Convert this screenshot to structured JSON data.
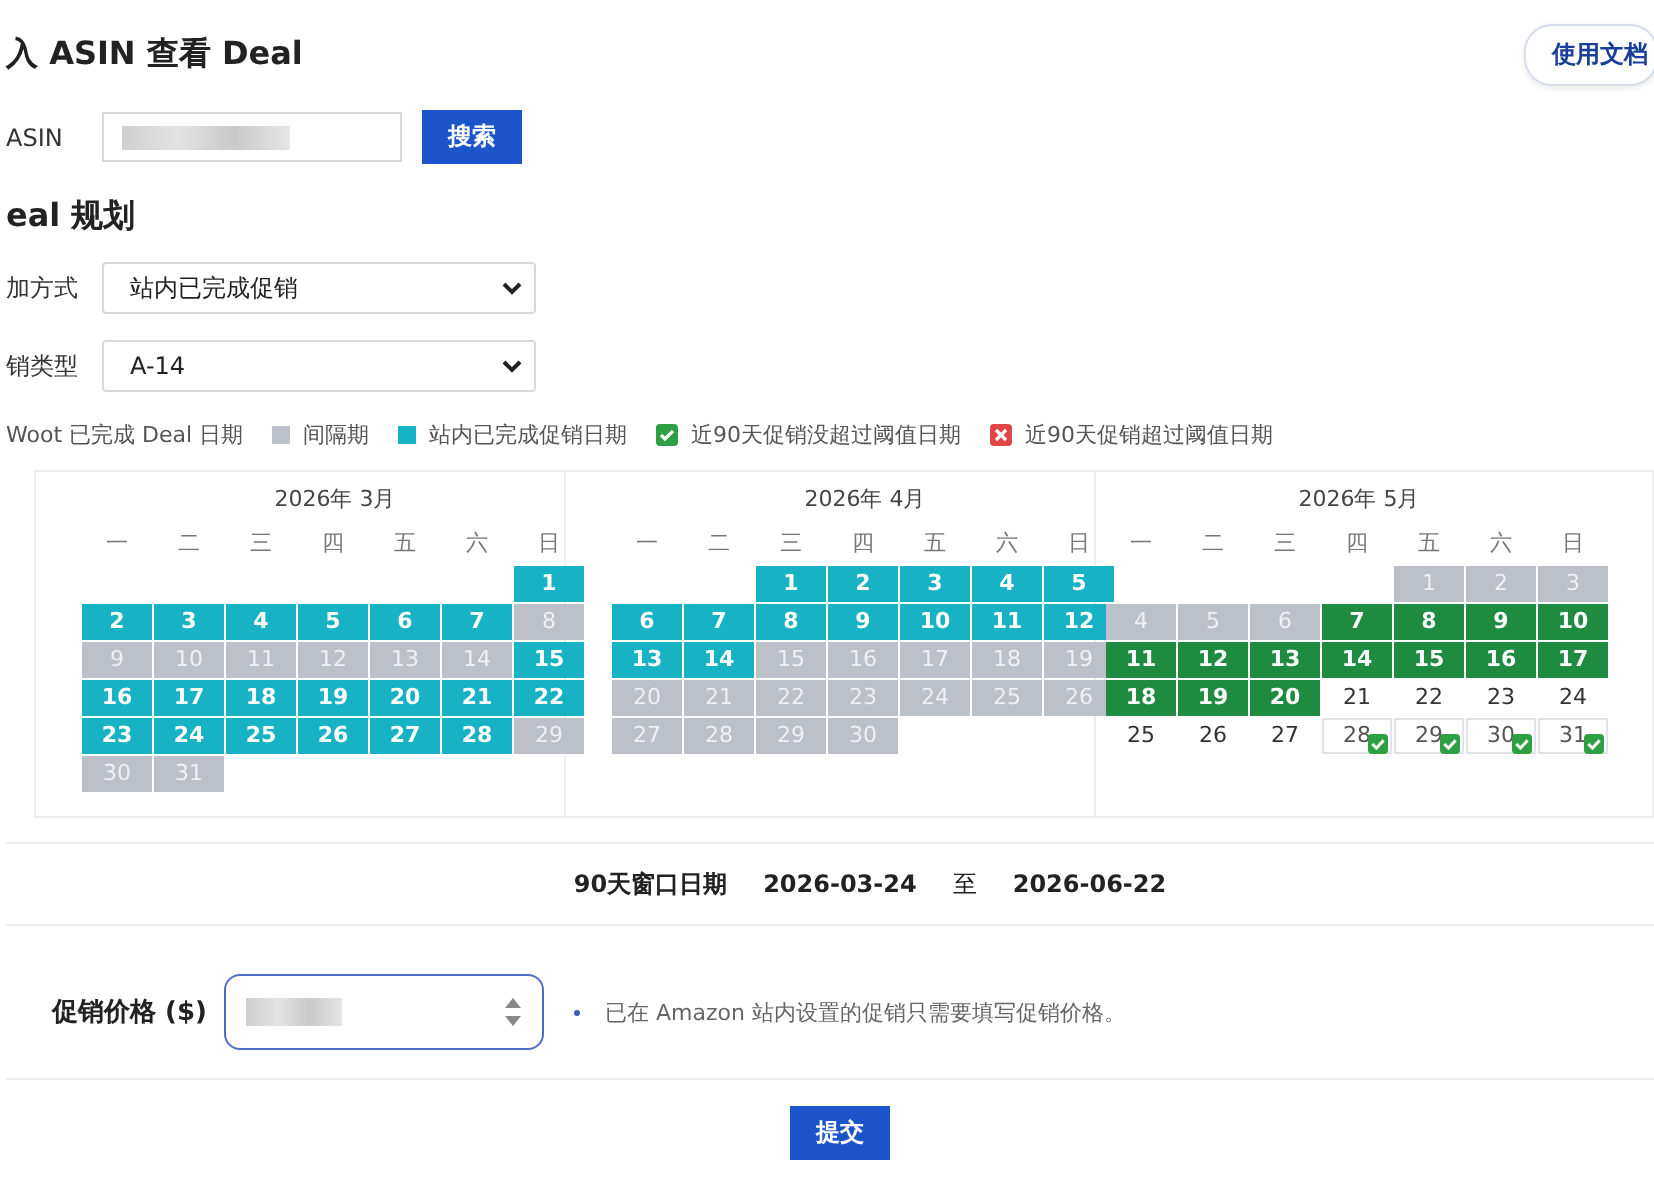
{
  "header": {
    "title": "入 ASIN 查看 Deal",
    "docs_button": "使用文档"
  },
  "asin": {
    "label": "ASIN",
    "button": "搜索"
  },
  "plan": {
    "title": "eal 规划",
    "fields": [
      {
        "label": "加方式",
        "value": "站内已完成促销"
      },
      {
        "label": "销类型",
        "value": "A-14"
      }
    ]
  },
  "legend": [
    {
      "label": "Woot 已完成 Deal 日期"
    },
    {
      "kind": "gap",
      "label": "间隔期"
    },
    {
      "kind": "promo",
      "label": "站内已完成促销日期"
    },
    {
      "kind": "ok",
      "label": "近90天促销没超过阈值日期"
    },
    {
      "kind": "over",
      "label": "近90天促销超过阈值日期"
    }
  ],
  "months": [
    {
      "title": "2026年 3月",
      "weekdays": [
        "一",
        "二",
        "三",
        "四",
        "五",
        "六",
        "日"
      ],
      "weeks": [
        [
          {
            "kind": "blank"
          },
          {
            "kind": "blank"
          },
          {
            "kind": "blank"
          },
          {
            "kind": "blank"
          },
          {
            "kind": "blank"
          },
          {
            "kind": "blank"
          },
          {
            "day": "1",
            "kind": "promo"
          }
        ],
        [
          {
            "day": "2",
            "kind": "promo"
          },
          {
            "day": "3",
            "kind": "promo"
          },
          {
            "day": "4",
            "kind": "promo"
          },
          {
            "day": "5",
            "kind": "promo"
          },
          {
            "day": "6",
            "kind": "promo"
          },
          {
            "day": "7",
            "kind": "promo"
          },
          {
            "day": "8",
            "kind": "gap"
          }
        ],
        [
          {
            "day": "9",
            "kind": "gap"
          },
          {
            "day": "10",
            "kind": "gap"
          },
          {
            "day": "11",
            "kind": "gap"
          },
          {
            "day": "12",
            "kind": "gap"
          },
          {
            "day": "13",
            "kind": "gap"
          },
          {
            "day": "14",
            "kind": "gap"
          },
          {
            "day": "15",
            "kind": "promo"
          }
        ],
        [
          {
            "day": "16",
            "kind": "promo"
          },
          {
            "day": "17",
            "kind": "promo"
          },
          {
            "day": "18",
            "kind": "promo"
          },
          {
            "day": "19",
            "kind": "promo"
          },
          {
            "day": "20",
            "kind": "promo"
          },
          {
            "day": "21",
            "kind": "promo"
          },
          {
            "day": "22",
            "kind": "promo"
          }
        ],
        [
          {
            "day": "23",
            "kind": "promo"
          },
          {
            "day": "24",
            "kind": "promo"
          },
          {
            "day": "25",
            "kind": "promo"
          },
          {
            "day": "26",
            "kind": "promo"
          },
          {
            "day": "27",
            "kind": "promo"
          },
          {
            "day": "28",
            "kind": "promo"
          },
          {
            "day": "29",
            "kind": "gap"
          }
        ],
        [
          {
            "day": "30",
            "kind": "gap"
          },
          {
            "day": "31",
            "kind": "gap"
          },
          {
            "kind": "blank"
          },
          {
            "kind": "blank"
          },
          {
            "kind": "blank"
          },
          {
            "kind": "blank"
          },
          {
            "kind": "blank"
          }
        ]
      ]
    },
    {
      "title": "2026年 4月",
      "weekdays": [
        "一",
        "二",
        "三",
        "四",
        "五",
        "六",
        "日"
      ],
      "weeks": [
        [
          {
            "kind": "blank"
          },
          {
            "kind": "blank"
          },
          {
            "day": "1",
            "kind": "promo"
          },
          {
            "day": "2",
            "kind": "promo"
          },
          {
            "day": "3",
            "kind": "promo"
          },
          {
            "day": "4",
            "kind": "promo"
          },
          {
            "day": "5",
            "kind": "promo"
          }
        ],
        [
          {
            "day": "6",
            "kind": "promo"
          },
          {
            "day": "7",
            "kind": "promo"
          },
          {
            "day": "8",
            "kind": "promo"
          },
          {
            "day": "9",
            "kind": "promo"
          },
          {
            "day": "10",
            "kind": "promo"
          },
          {
            "day": "11",
            "kind": "promo"
          },
          {
            "day": "12",
            "kind": "promo"
          }
        ],
        [
          {
            "day": "13",
            "kind": "promo"
          },
          {
            "day": "14",
            "kind": "promo"
          },
          {
            "day": "15",
            "kind": "gap"
          },
          {
            "day": "16",
            "kind": "gap"
          },
          {
            "day": "17",
            "kind": "gap"
          },
          {
            "day": "18",
            "kind": "gap"
          },
          {
            "day": "19",
            "kind": "gap"
          }
        ],
        [
          {
            "day": "20",
            "kind": "gap"
          },
          {
            "day": "21",
            "kind": "gap"
          },
          {
            "day": "22",
            "kind": "gap"
          },
          {
            "day": "23",
            "kind": "gap"
          },
          {
            "day": "24",
            "kind": "gap"
          },
          {
            "day": "25",
            "kind": "gap"
          },
          {
            "day": "26",
            "kind": "gap"
          }
        ],
        [
          {
            "day": "27",
            "kind": "gap"
          },
          {
            "day": "28",
            "kind": "gap"
          },
          {
            "day": "29",
            "kind": "gap"
          },
          {
            "day": "30",
            "kind": "gap"
          },
          {
            "kind": "blank"
          },
          {
            "kind": "blank"
          },
          {
            "kind": "blank"
          }
        ]
      ]
    },
    {
      "title": "2026年 5月",
      "weekdays": [
        "一",
        "二",
        "三",
        "四",
        "五",
        "六",
        "日"
      ],
      "weeks": [
        [
          {
            "kind": "blank"
          },
          {
            "kind": "blank"
          },
          {
            "kind": "blank"
          },
          {
            "kind": "blank"
          },
          {
            "day": "1",
            "kind": "gap"
          },
          {
            "day": "2",
            "kind": "gap"
          },
          {
            "day": "3",
            "kind": "gap"
          }
        ],
        [
          {
            "day": "4",
            "kind": "gap"
          },
          {
            "day": "5",
            "kind": "gap"
          },
          {
            "day": "6",
            "kind": "gap"
          },
          {
            "day": "7",
            "kind": "woot"
          },
          {
            "day": "8",
            "kind": "woot"
          },
          {
            "day": "9",
            "kind": "woot"
          },
          {
            "day": "10",
            "kind": "woot"
          }
        ],
        [
          {
            "day": "11",
            "kind": "woot"
          },
          {
            "day": "12",
            "kind": "woot"
          },
          {
            "day": "13",
            "kind": "woot"
          },
          {
            "day": "14",
            "kind": "woot"
          },
          {
            "day": "15",
            "kind": "woot"
          },
          {
            "day": "16",
            "kind": "woot"
          },
          {
            "day": "17",
            "kind": "woot"
          }
        ],
        [
          {
            "day": "18",
            "kind": "woot"
          },
          {
            "day": "19",
            "kind": "woot"
          },
          {
            "day": "20",
            "kind": "woot"
          },
          {
            "day": "21",
            "kind": "plain"
          },
          {
            "day": "22",
            "kind": "plain"
          },
          {
            "day": "23",
            "kind": "plain"
          },
          {
            "day": "24",
            "kind": "plain"
          }
        ],
        [
          {
            "day": "25",
            "kind": "plain"
          },
          {
            "day": "26",
            "kind": "plain"
          },
          {
            "day": "27",
            "kind": "plain"
          },
          {
            "day": "28",
            "kind": "ok"
          },
          {
            "day": "29",
            "kind": "ok"
          },
          {
            "day": "30",
            "kind": "ok"
          },
          {
            "day": "31",
            "kind": "ok"
          }
        ]
      ]
    }
  ],
  "window": {
    "label": "90天窗口日期",
    "start": "2026-03-24",
    "separator": "至",
    "end": "2026-06-22"
  },
  "price": {
    "label": "促销价格 ($)",
    "note": "已在 Amazon 站内设置的促销只需要填写促销价格。"
  },
  "submit": "提交"
}
